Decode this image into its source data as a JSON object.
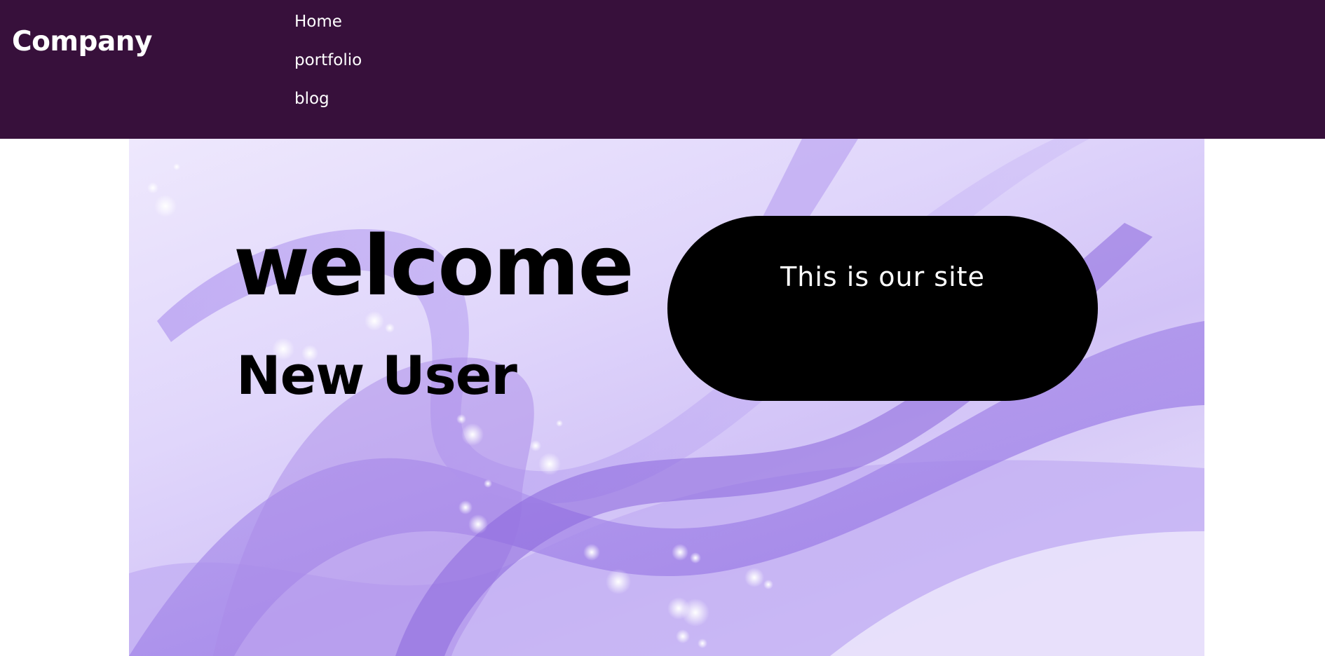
{
  "header": {
    "logo": "Company",
    "nav": [
      {
        "label": "Home"
      },
      {
        "label": "portfolio"
      },
      {
        "label": "blog"
      }
    ]
  },
  "hero": {
    "title": "welcome",
    "subtitle": "New User",
    "card_text": "This is our site"
  },
  "colors": {
    "header_bg": "#37103b",
    "hero_accent": "#9a7ae8",
    "card_bg": "#000000"
  }
}
